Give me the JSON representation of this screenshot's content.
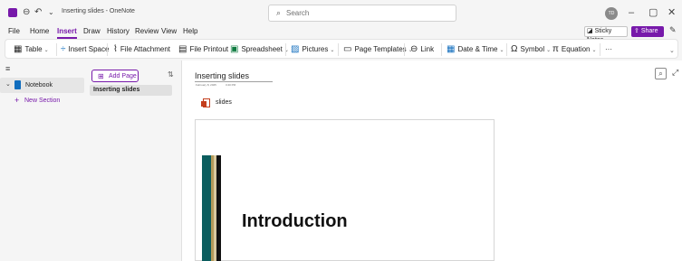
{
  "window": {
    "title": "Inserting slides - OneNote"
  },
  "search": {
    "placeholder": "Search"
  },
  "user": {
    "initials": "TD"
  },
  "menu": {
    "items": [
      "File",
      "Home",
      "Insert",
      "Draw",
      "History",
      "Review",
      "View",
      "Help"
    ],
    "active": "Insert",
    "sticky_notes": "Sticky Notes",
    "share": "Share"
  },
  "ribbon": {
    "table": "Table",
    "insert_space": "Insert Space",
    "file_attachment": "File Attachment",
    "file_printout": "File Printout",
    "spreadsheet": "Spreadsheet",
    "pictures": "Pictures",
    "page_templates": "Page Templates",
    "link": "Link",
    "date_time": "Date & Time",
    "symbol": "Symbol",
    "equation": "Equation",
    "more": "···"
  },
  "notebooks": {
    "current": "Notebook",
    "new_section": "New Section"
  },
  "pages": {
    "add_page": "Add Page",
    "items": [
      "Inserting slides"
    ]
  },
  "page": {
    "title": "Inserting slides",
    "date": "February 8, 2025",
    "time": "3:40 PM",
    "attachment_label": "slides",
    "slide_heading": "Introduction"
  },
  "colors": {
    "accent": "#7719aa",
    "slide_teal": "#0b5d5e",
    "slide_gold": "#b49a5a",
    "slide_black": "#111111"
  }
}
